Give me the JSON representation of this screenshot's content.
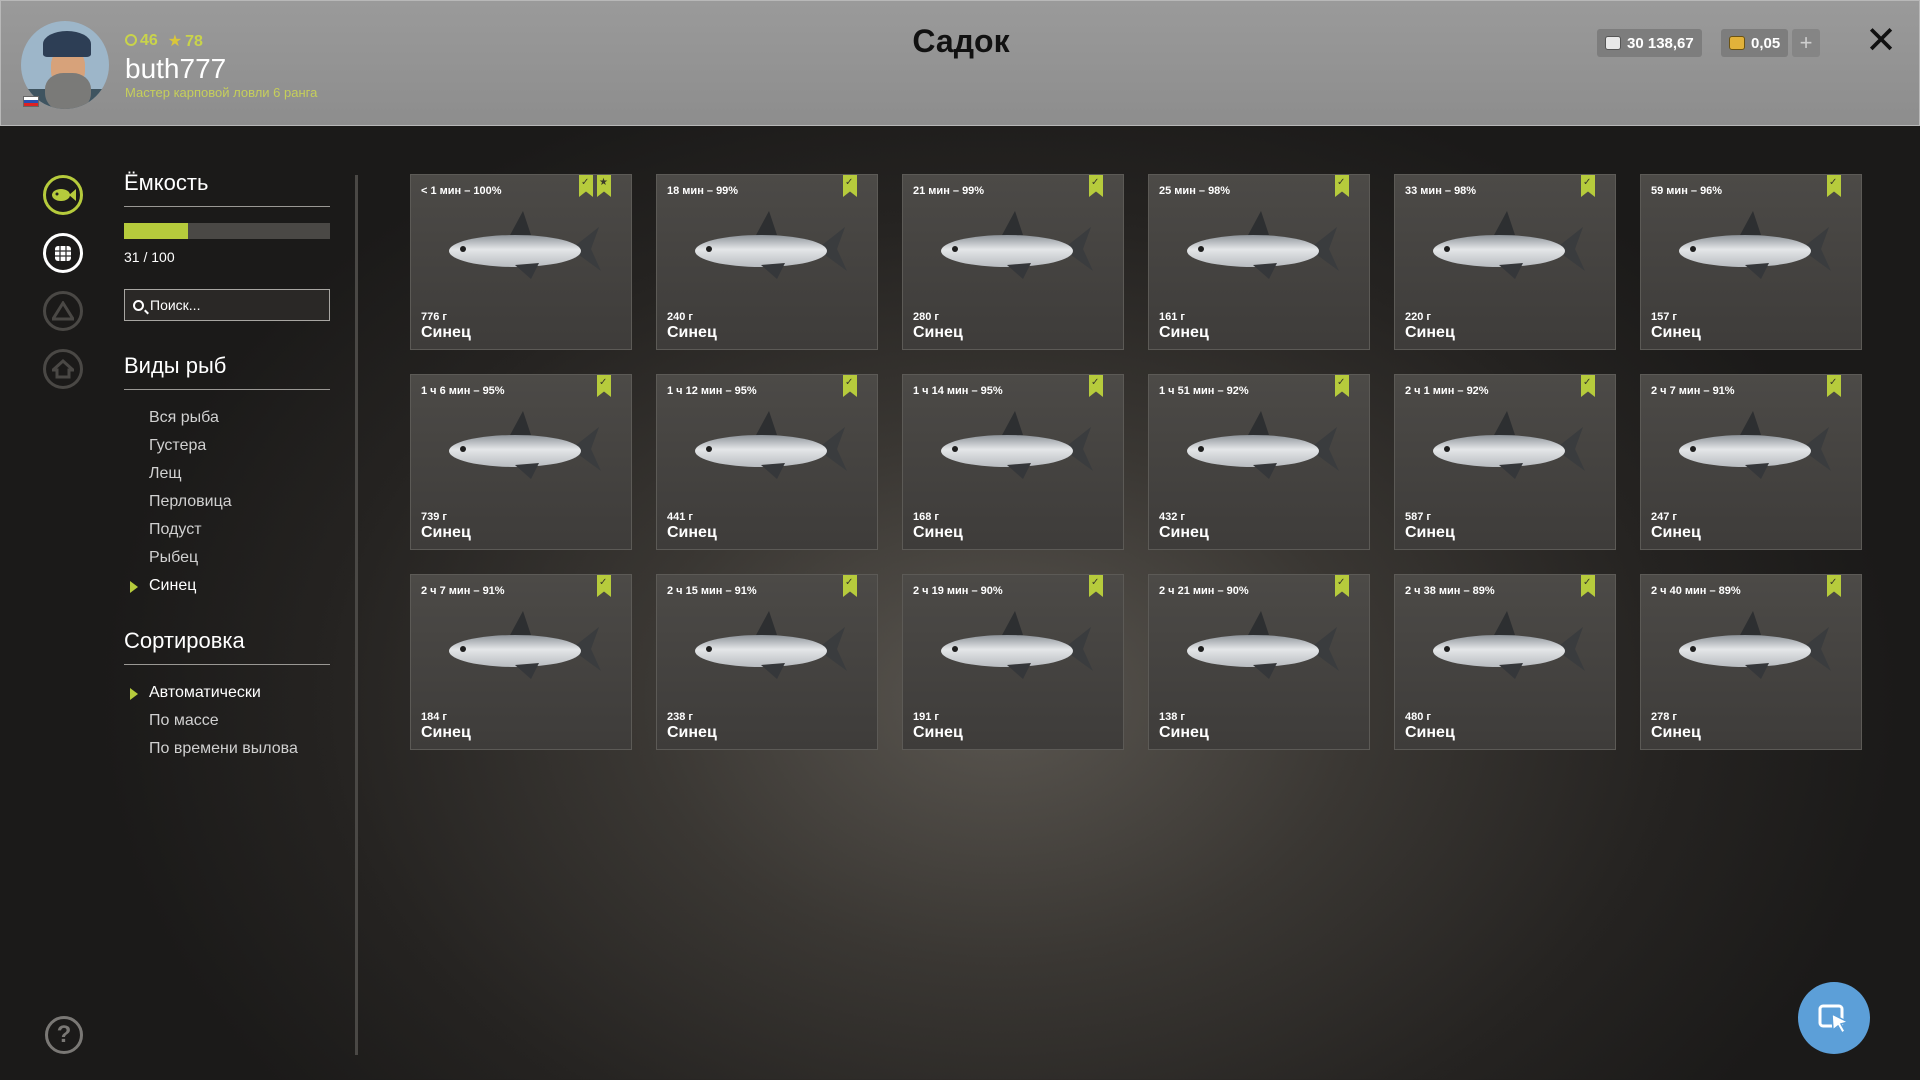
{
  "header": {
    "title": "Садок",
    "player": {
      "level": "46",
      "stars": "78",
      "username": "buth777",
      "rank": "Мастер карповой ловли 6 ранга"
    },
    "currency": {
      "silver": "30 138,67",
      "gold": "0,05"
    }
  },
  "panel": {
    "capacity_title": "Ёмкость",
    "capacity_text": "31 / 100",
    "capacity_fraction": 0.31,
    "search_placeholder": "Поиск...",
    "species_title": "Виды рыб",
    "species": [
      "Вся рыба",
      "Густера",
      "Лещ",
      "Перловица",
      "Подуст",
      "Рыбец",
      "Синец"
    ],
    "species_selected": 6,
    "sort_title": "Сортировка",
    "sort": [
      "Автоматически",
      "По массе",
      "По времени вылова"
    ],
    "sort_selected": 0
  },
  "catches": [
    {
      "time": "< 1 мин – 100%",
      "weight": "776 г",
      "name": "Синец",
      "star": true
    },
    {
      "time": "18 мин – 99%",
      "weight": "240 г",
      "name": "Синец",
      "star": false
    },
    {
      "time": "21 мин – 99%",
      "weight": "280 г",
      "name": "Синец",
      "star": false
    },
    {
      "time": "25 мин – 98%",
      "weight": "161 г",
      "name": "Синец",
      "star": false
    },
    {
      "time": "33 мин – 98%",
      "weight": "220 г",
      "name": "Синец",
      "star": false
    },
    {
      "time": "59 мин – 96%",
      "weight": "157 г",
      "name": "Синец",
      "star": false
    },
    {
      "time": "1 ч 6 мин – 95%",
      "weight": "739 г",
      "name": "Синец",
      "star": false
    },
    {
      "time": "1 ч 12 мин – 95%",
      "weight": "441 г",
      "name": "Синец",
      "star": false
    },
    {
      "time": "1 ч 14 мин – 95%",
      "weight": "168 г",
      "name": "Синец",
      "star": false
    },
    {
      "time": "1 ч 51 мин – 92%",
      "weight": "432 г",
      "name": "Синец",
      "star": false
    },
    {
      "time": "2 ч 1 мин – 92%",
      "weight": "587 г",
      "name": "Синец",
      "star": false
    },
    {
      "time": "2 ч 7 мин – 91%",
      "weight": "247 г",
      "name": "Синец",
      "star": false
    },
    {
      "time": "2 ч 7 мин – 91%",
      "weight": "184 г",
      "name": "Синец",
      "star": false
    },
    {
      "time": "2 ч 15 мин – 91%",
      "weight": "238 г",
      "name": "Синец",
      "star": false
    },
    {
      "time": "2 ч 19 мин – 90%",
      "weight": "191 г",
      "name": "Синец",
      "star": false
    },
    {
      "time": "2 ч 21 мин – 90%",
      "weight": "138 г",
      "name": "Синец",
      "star": false
    },
    {
      "time": "2 ч 38 мин – 89%",
      "weight": "480 г",
      "name": "Синец",
      "star": false
    },
    {
      "time": "2 ч 40 мин – 89%",
      "weight": "278 г",
      "name": "Синец",
      "star": false
    }
  ],
  "icons": {
    "rail": [
      "fish-icon",
      "keepnet-icon",
      "camp-icon",
      "home-icon"
    ],
    "help": "help-icon",
    "fab": "cursor-icon"
  },
  "colors": {
    "accent": "#b6cb3c",
    "fab": "#5c9fd8"
  }
}
